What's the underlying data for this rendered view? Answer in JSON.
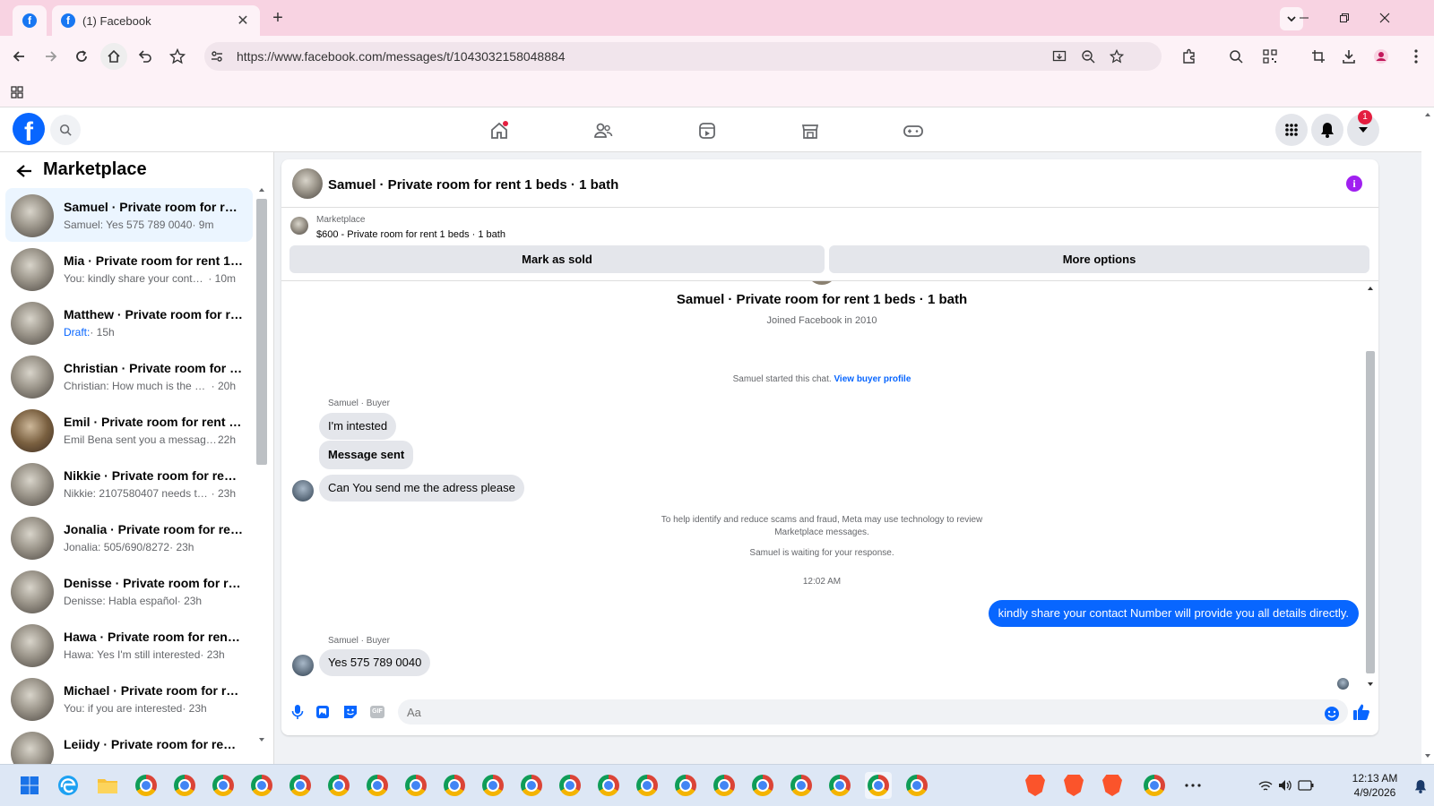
{
  "browser": {
    "tab_title": "(1) Facebook",
    "new_tab_label": "+",
    "close_tab_label": "✕",
    "url": "https://www.facebook.com/messages/t/1043032158048884"
  },
  "fb_header": {
    "logo_letter": "f",
    "notification_count": "1"
  },
  "sidebar": {
    "title": "Marketplace",
    "conversations": [
      {
        "name": "Samuel · Private room for rent 1...",
        "preview": "Samuel: Yes 575 789 0040",
        "time": " · 9m",
        "active": true
      },
      {
        "name": "Mia · Private room for rent 1 be...",
        "preview": "You: kindly share your contact N...",
        "time": " · 10m"
      },
      {
        "name": "Matthew · Private room for rent...",
        "preview": "Draft:",
        "time": " · 15h"
      },
      {
        "name": "Christian · Private room for rent...",
        "preview": "Christian: How much is the depo...",
        "time": " · 20h"
      },
      {
        "name": "Emil · Private room for rent 1 be...",
        "preview": "Emil Bena sent you a message ab...",
        "time": " 22h"
      },
      {
        "name": "Nikkie · Private room for rent 1 ...",
        "preview": "Nikkie: 2107580407 needs to be i...",
        "time": " · 23h"
      },
      {
        "name": "Jonalia · Private room for rent 1...",
        "preview": "Jonalia: 505/690/8272",
        "time": " · 23h"
      },
      {
        "name": "Denisse · Private room for rent ...",
        "preview": "Denisse: Habla español",
        "time": " · 23h"
      },
      {
        "name": "Hawa · Private room for rent 1 ...",
        "preview": "Hawa: Yes I'm still interested",
        "time": " · 23h"
      },
      {
        "name": "Michael · Private room for rent ...",
        "preview": "You: if you are interested",
        "time": " · 23h"
      },
      {
        "name": "Leiidy · Private room for rent ...",
        "preview": "",
        "time": ""
      }
    ]
  },
  "chat": {
    "title": "Samuel · Private room for rent 1 beds · 1 bath",
    "info_label": "i",
    "listing": {
      "label": "Marketplace",
      "price_title": "$600 - Private room for rent 1 beds · 1 bath",
      "mark_sold": "Mark as sold",
      "more_options": "More options"
    },
    "profile_name": "Samuel · Private room for rent 1 beds · 1 bath",
    "joined": "Joined Facebook in 2010",
    "started_text": "Samuel started this chat.",
    "view_buyer_profile": "View buyer profile",
    "sender_label": "Samuel · Buyer",
    "messages": {
      "m1": "I'm intested",
      "m2": "Message sent",
      "m3": "Can You send me the adress please",
      "notice": "To help identify and reduce scams and fraud, Meta may use technology to review Marketplace messages.",
      "waiting": "Samuel is waiting for your response.",
      "timestamp": "12:02 AM",
      "out": "kindly share your contact Number will provide you all details directly.",
      "sender_label_2": "Samuel · Buyer",
      "m4": "Yes 575 789 0040"
    },
    "composer": {
      "placeholder": "Aa",
      "gif_label": "GIF"
    }
  },
  "taskbar": {
    "time": "12:13 AM",
    "date": "4/9/2026"
  }
}
